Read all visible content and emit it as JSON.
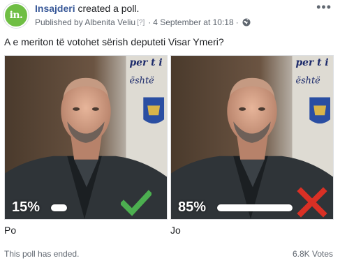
{
  "header": {
    "avatar_text": "in.",
    "page_name": "Insajderi",
    "action": "created a poll.",
    "published_by": "Published by Albenita Veliu",
    "bracket_tag": "[?]",
    "date": "4 September at 10:18",
    "separator": "·",
    "privacy_icon": "globe-icon",
    "more_icon": "ellipsis-icon",
    "more_text": "•••"
  },
  "poll": {
    "question": "A e meriton të votohet sërish deputeti Visar Ymeri?",
    "options": [
      {
        "label": "Po",
        "percent_text": "15%",
        "percent": 15,
        "mark": "check-icon",
        "mark_color": "#4caf50"
      },
      {
        "label": "Jo",
        "percent_text": "85%",
        "percent": 85,
        "mark": "x-icon",
        "mark_color": "#d93025"
      }
    ],
    "banner_text": "per t i\nështë"
  },
  "footer": {
    "status": "This poll has ended.",
    "votes": "6.8K Votes"
  },
  "colors": {
    "link": "#385898",
    "avatar_bg": "#6fbe44",
    "muted": "#606770"
  }
}
